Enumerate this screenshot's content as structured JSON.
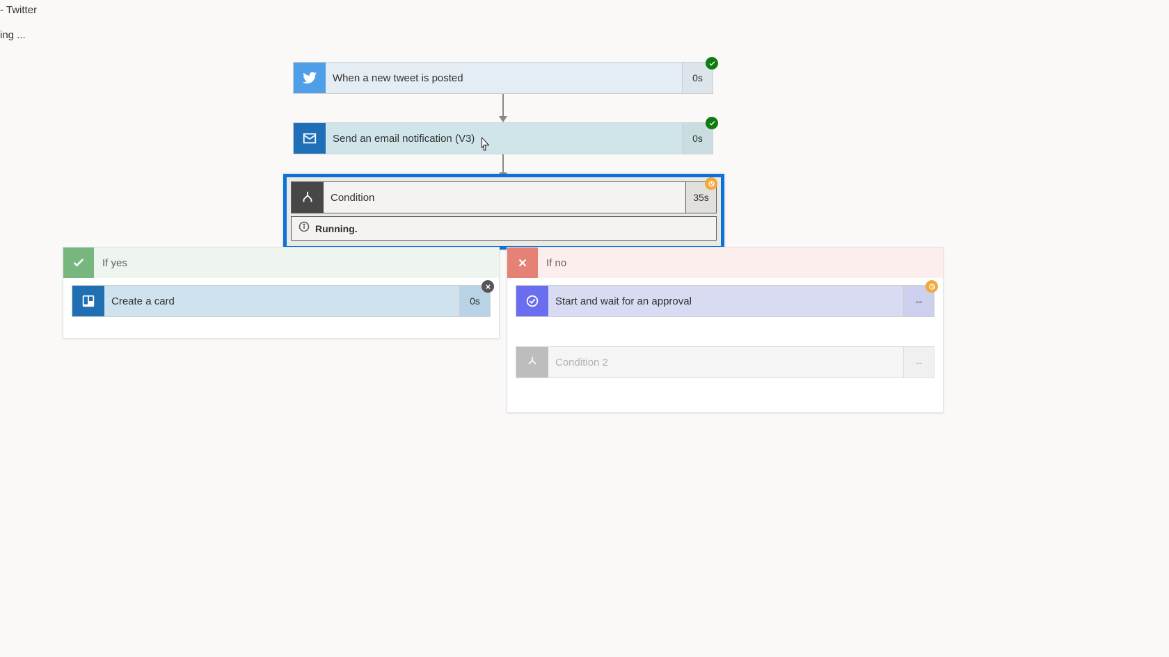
{
  "header": {
    "tab_title": "- Twitter",
    "loading_text": "ing ..."
  },
  "steps": {
    "trigger": {
      "label": "When a new tweet is posted",
      "duration": "0s",
      "status": "success"
    },
    "email": {
      "label": "Send an email notification (V3)",
      "duration": "0s",
      "status": "success"
    },
    "condition": {
      "label": "Condition",
      "duration": "35s",
      "status": "running",
      "running_text": "Running."
    }
  },
  "branches": {
    "yes": {
      "title": "If yes",
      "steps": [
        {
          "id": "trello",
          "label": "Create a card",
          "duration": "0s",
          "status": "cancelled"
        }
      ]
    },
    "no": {
      "title": "If no",
      "steps": [
        {
          "id": "approval",
          "label": "Start and wait for an approval",
          "duration": "--",
          "status": "running"
        },
        {
          "id": "cond2",
          "label": "Condition 2",
          "duration": "--",
          "status": "none"
        }
      ]
    }
  }
}
